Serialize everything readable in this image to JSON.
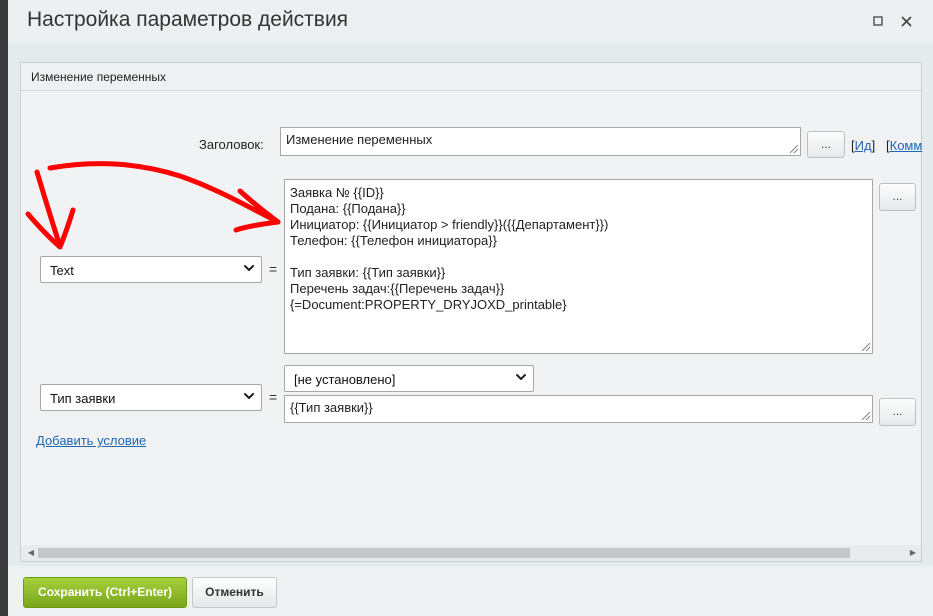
{
  "dialog": {
    "title": "Настройка параметров действия",
    "maximize_icon": "square-icon",
    "close_icon": "close-icon"
  },
  "panel": {
    "title": "Изменение переменных"
  },
  "header_row": {
    "label": "Заголовок:",
    "value": "Изменение переменных",
    "dots_label": "...",
    "id_link": "Ид",
    "comment_link": "Комм"
  },
  "rows": [
    {
      "variable": "Text",
      "equals": "=",
      "value_lines": [
        "Заявка № {{ID}}",
        "Подана: {{Подана}}",
        "Инициатор: {{Инициатор > friendly}}({{Департамент}})",
        "Телефон: {{Телефон инициатора}}",
        "",
        "Тип заявки: {{Тип заявки}}",
        "Перечень задач:{{Перечень задач}}",
        "{=Document:PROPERTY_DRYJOXD_printable}"
      ],
      "dots_label": "..."
    },
    {
      "variable": "Тип заявки",
      "equals": "=",
      "option_selected": "[не установлено]",
      "value": "{{Тип заявки}}",
      "dots_label": "..."
    }
  ],
  "add_condition_link": "Добавить условие",
  "buttons": {
    "save": "Сохранить (Ctrl+Enter)",
    "cancel": "Отменить"
  },
  "annotation_color": "#ff0000"
}
